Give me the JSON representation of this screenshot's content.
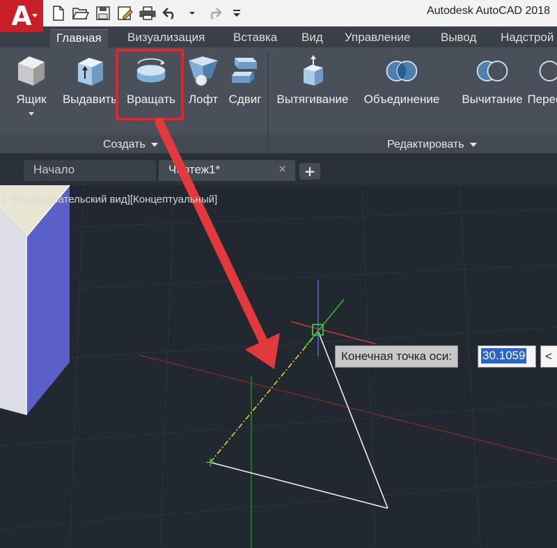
{
  "app": {
    "title": "Autodesk AutoCAD 2018",
    "logo_letter": "A"
  },
  "quick_access": [
    {
      "name": "new-icon"
    },
    {
      "name": "open-icon"
    },
    {
      "name": "save-icon"
    },
    {
      "name": "save-as-icon"
    },
    {
      "name": "plot-icon"
    },
    {
      "name": "undo-icon"
    },
    {
      "name": "redo-icon"
    },
    {
      "name": "customize-icon"
    }
  ],
  "ribbon_tabs": [
    {
      "label": "Главная",
      "active": true
    },
    {
      "label": "Визуализация"
    },
    {
      "label": "Вставка"
    },
    {
      "label": "Вид"
    },
    {
      "label": "Управление"
    },
    {
      "label": "Вывод"
    },
    {
      "label": "Надстрой"
    }
  ],
  "create_panel": {
    "title": "Создать",
    "tools": [
      {
        "label": "Ящик",
        "icon": "box-icon"
      },
      {
        "label": "Выдавить",
        "icon": "extrude-icon"
      },
      {
        "label": "Вращать",
        "icon": "revolve-icon",
        "highlighted": true
      },
      {
        "label": "Лофт",
        "icon": "loft-icon"
      },
      {
        "label": "Сдвиг",
        "icon": "sweep-icon"
      }
    ]
  },
  "edit_panel": {
    "title": "Редактировать",
    "tools": [
      {
        "label": "Вытягивание",
        "icon": "presspull-icon"
      },
      {
        "label": "Объединение",
        "icon": "union-icon"
      },
      {
        "label": "Вычитание",
        "icon": "subtract-icon"
      },
      {
        "label": "Перес",
        "icon": "intersect-icon"
      }
    ]
  },
  "file_tabs": [
    {
      "label": "Начало"
    },
    {
      "label": "Чертеж1*",
      "active": true
    }
  ],
  "viewport": {
    "label": "[−][Пользовательский вид][Концептуальный]"
  },
  "dynamic_input": {
    "prompt": "Конечная точка оси:",
    "value": "30.1059",
    "angle_marker": "<"
  },
  "colors": {
    "accent_red": "#e0262c",
    "ribbon_bg": "#4a5059",
    "viewport_bg": "#212830",
    "app_red": "#c81f28"
  }
}
